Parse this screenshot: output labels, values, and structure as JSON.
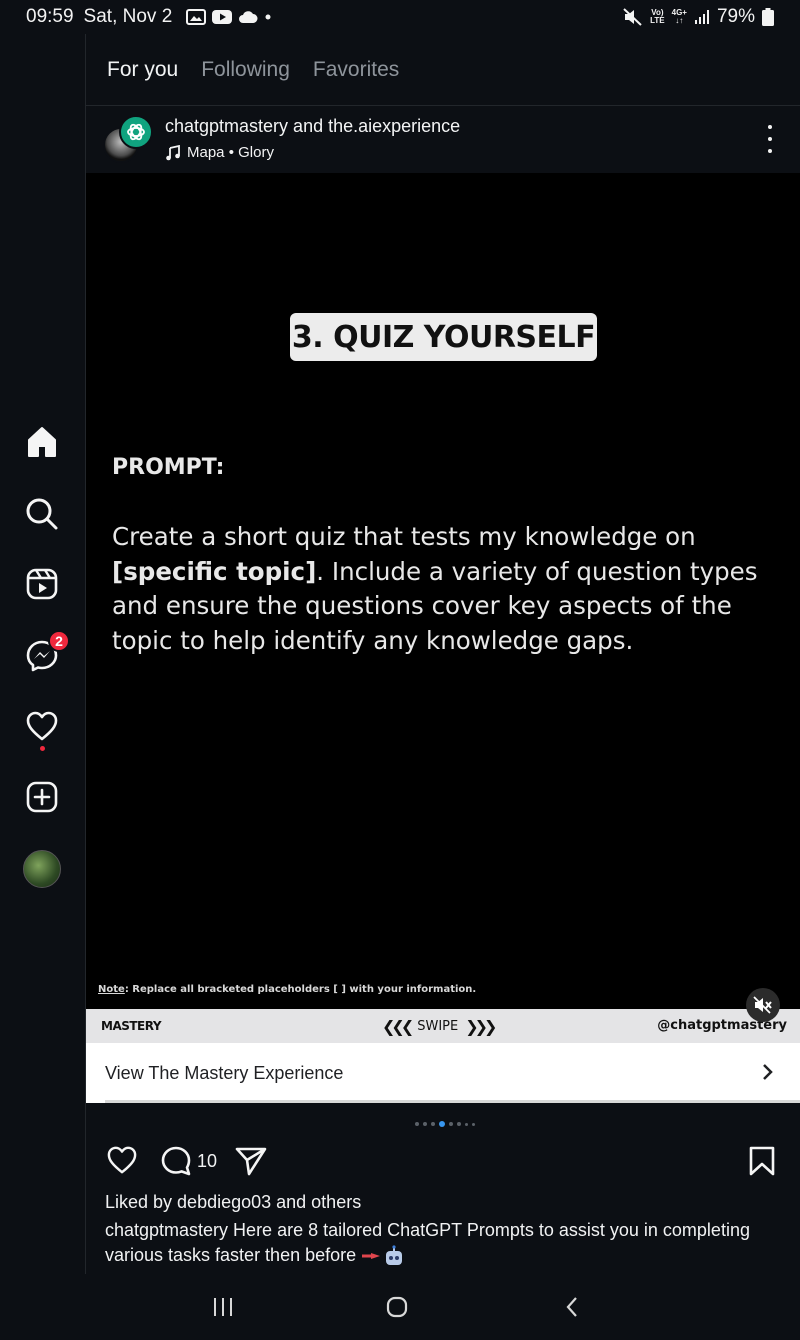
{
  "status": {
    "time": "09:59",
    "date": "Sat, Nov 2",
    "net_top": "Vo)",
    "net_bottom": "LTE",
    "net2_top": "4G+",
    "battery": "79%"
  },
  "tabs": [
    {
      "label": "For you",
      "active": true
    },
    {
      "label": "Following",
      "active": false
    },
    {
      "label": "Favorites",
      "active": false
    }
  ],
  "nav": {
    "messages_badge": "2"
  },
  "post": {
    "authors": "chatgptmastery and the.aiexperience",
    "music": "Mapa • Glory"
  },
  "slide": {
    "heading": "3. QUIZ YOURSELF",
    "prompt_label": "PROMPT:",
    "prompt_text_before": "Create a short quiz that tests my knowledge on ",
    "prompt_text_bold": "[specific topic]",
    "prompt_text_after": ". Include a variety of question types and ensure the questions cover key aspects of the topic to help identify any knowledge gaps.",
    "note_label": "Note",
    "note_text": ": Replace all bracketed placeholders [ ] with your information.",
    "footer_left": "MASTERY",
    "footer_mid": "SWIPE",
    "footer_right": "@chatgptmastery"
  },
  "cta": {
    "label": "View The Mastery Experience"
  },
  "carousel": {
    "total": 8,
    "current": 4
  },
  "actions": {
    "comment_count": "10"
  },
  "liked_by": "Liked by debdiego03 and others",
  "caption": "chatgptmastery Here are 8 tailored ChatGPT Prompts to assist you in completing various tasks faster then before"
}
